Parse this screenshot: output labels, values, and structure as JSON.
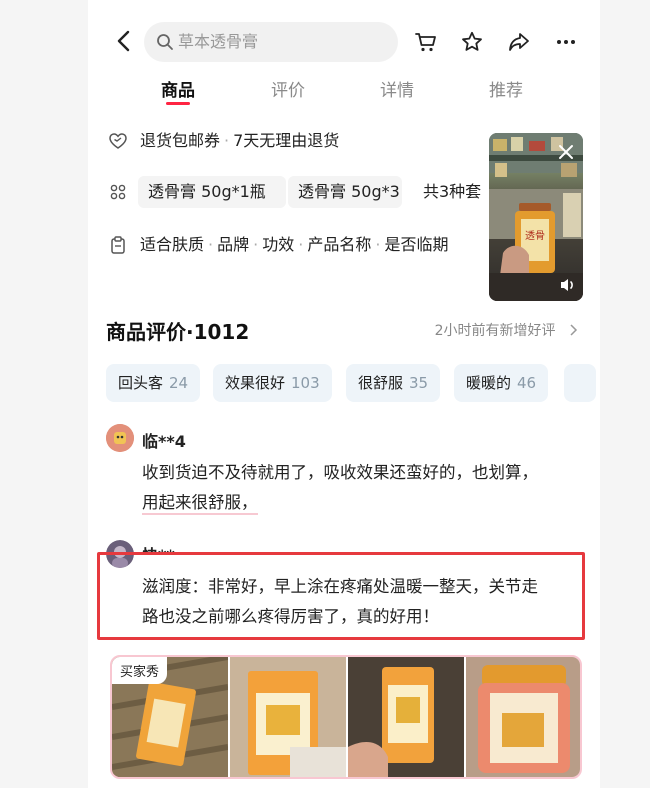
{
  "header": {
    "search_placeholder": "草本透骨膏"
  },
  "tabs": [
    {
      "label": "商品"
    },
    {
      "label": "评价"
    },
    {
      "label": "详情"
    },
    {
      "label": "推荐"
    }
  ],
  "info": {
    "return_label": "退货包邮券",
    "return_policy": "7天无理由退货",
    "sku_chip_1": "透骨膏 50g*1瓶",
    "sku_chip_2": "透骨膏 50g*3",
    "sku_total": "共3种套",
    "attrs": [
      "适合肤质",
      "品牌",
      "功效",
      "产品名称",
      "是否临期"
    ]
  },
  "reviews": {
    "title": "商品评价·1012",
    "more": "2小时前有新增好评",
    "tags": [
      {
        "label": "回头客",
        "count": "24"
      },
      {
        "label": "效果很好",
        "count": "103"
      },
      {
        "label": "很舒服",
        "count": "35"
      },
      {
        "label": "暖暖的",
        "count": "46"
      }
    ],
    "items": [
      {
        "user": "临**4",
        "line1": "收到货迫不及待就用了，吸收效果还蛮好的，也划算，",
        "line2": "用起来很舒服，"
      },
      {
        "user": "快**r",
        "line1": "滋润度：非常好，早上涂在疼痛处温暖一整天，关节走",
        "line2": "路也没之前哪么疼得厉害了，真的好用！"
      }
    ],
    "photos_badge": "买家秀"
  },
  "colors": {
    "accent": "#ff2442",
    "highlight_box": "#e6393e",
    "tag_bg": "#eef4f9"
  }
}
